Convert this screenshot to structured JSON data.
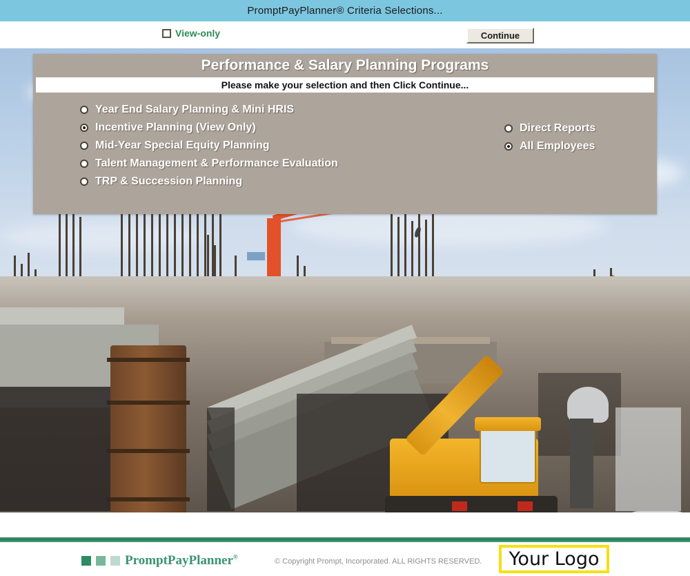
{
  "window": {
    "title": "PromptPayPlanner®  Criteria Selections..."
  },
  "toolbar": {
    "view_only_label": "View-only",
    "view_only_checked": false,
    "continue_label": "Continue"
  },
  "panel": {
    "title": "Performance & Salary Planning Programs",
    "instruction": "Please make your selection and then Click Continue...",
    "bg_color": "#ada49c",
    "programs": [
      {
        "label": "Year End Salary Planning & Mini HRIS",
        "selected": false
      },
      {
        "label": "Incentive Planning (View Only)",
        "selected": true
      },
      {
        "label": "Mid-Year Special Equity Planning",
        "selected": false
      },
      {
        "label": "Talent Management & Performance Evaluation",
        "selected": false
      },
      {
        "label": "TRP & Succession Planning",
        "selected": false
      }
    ],
    "scope": [
      {
        "label": "Direct Reports",
        "selected": false
      },
      {
        "label": "All Employees",
        "selected": true
      }
    ]
  },
  "background": {
    "description": "Construction site photograph with orange tower crane, yellow mobile crane and excavator, rebar columns and concrete stairs"
  },
  "footer": {
    "brand": "PromptPayPlanner",
    "brand_mark": "®",
    "copyright": "© Copyright Prompt, Incorporated. ALL RIGHTS RESERVED.",
    "logo_placeholder": "Your Logo",
    "logo_border_color": "#f5e016",
    "rule_color": "#2f7c59",
    "brand_color": "#3b9470",
    "swatches": [
      "#2e8b62",
      "#79b79b",
      "#bcdbcd"
    ]
  },
  "colors": {
    "titlebar": "#7cc6e0",
    "accent_green": "#2e8b57"
  }
}
